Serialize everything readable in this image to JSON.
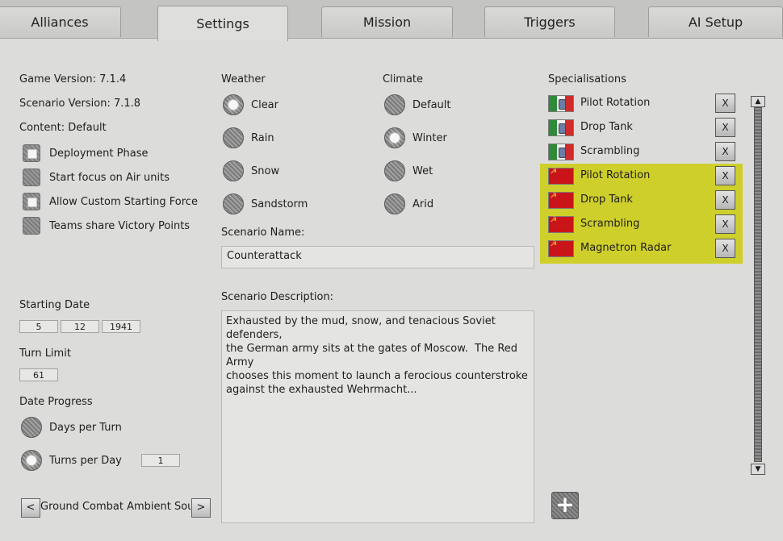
{
  "tabs": [
    "Alliances",
    "Settings",
    "Mission",
    "Triggers",
    "AI Setup"
  ],
  "info": {
    "game_version": "Game Version: 7.1.4",
    "scenario_version": "Scenario Version: 7.1.8",
    "content": "Content: Default"
  },
  "options": [
    {
      "label": "Deployment Phase",
      "checked": true
    },
    {
      "label": "Start focus on Air units",
      "checked": false
    },
    {
      "label": "Allow Custom Starting Force",
      "checked": true
    },
    {
      "label": "Teams share Victory Points",
      "checked": false
    }
  ],
  "weather": {
    "label": "Weather",
    "items": [
      "Clear",
      "Rain",
      "Snow",
      "Sandstorm"
    ],
    "selected": "Clear"
  },
  "climate": {
    "label": "Climate",
    "items": [
      "Default",
      "Winter",
      "Wet",
      "Arid"
    ],
    "selected": "Winter"
  },
  "scenario": {
    "name_label": "Scenario Name:",
    "name": "Counterattack",
    "desc_label": "Scenario Description:",
    "description": "Exhausted by the mud, snow, and tenacious Soviet defenders,\nthe German army sits at the gates of Moscow.  The Red Army\nchooses this moment to launch a ferocious counterstroke\nagainst the exhausted Wehrmacht..."
  },
  "starting_date": {
    "label": "Starting Date",
    "day": "5",
    "month": "12",
    "year": "1941"
  },
  "turn_limit": {
    "label": "Turn Limit",
    "value": "61"
  },
  "date_progress": {
    "label": "Date Progress",
    "days_per_turn": "Days per Turn",
    "turns_per_day": "Turns per Day",
    "turns_per_day_value": "1",
    "selected": "Days per Turn"
  },
  "ambient": {
    "label": "Ground Combat Ambient Sound",
    "prev": "<",
    "next": ">"
  },
  "specialisations": {
    "label": "Specialisations",
    "remove_label": "X",
    "add_label": "+",
    "highlight_color": "#cfcf2c",
    "items": [
      {
        "nation": "Italy",
        "label": "Pilot Rotation",
        "highlighted": false
      },
      {
        "nation": "Italy",
        "label": "Drop Tank",
        "highlighted": false
      },
      {
        "nation": "Italy",
        "label": "Scrambling",
        "highlighted": false
      },
      {
        "nation": "USSR",
        "label": "Pilot Rotation",
        "highlighted": true
      },
      {
        "nation": "USSR",
        "label": "Drop Tank",
        "highlighted": true
      },
      {
        "nation": "USSR",
        "label": "Scrambling",
        "highlighted": true
      },
      {
        "nation": "USSR",
        "label": "Magnetron Radar",
        "highlighted": true
      }
    ]
  }
}
